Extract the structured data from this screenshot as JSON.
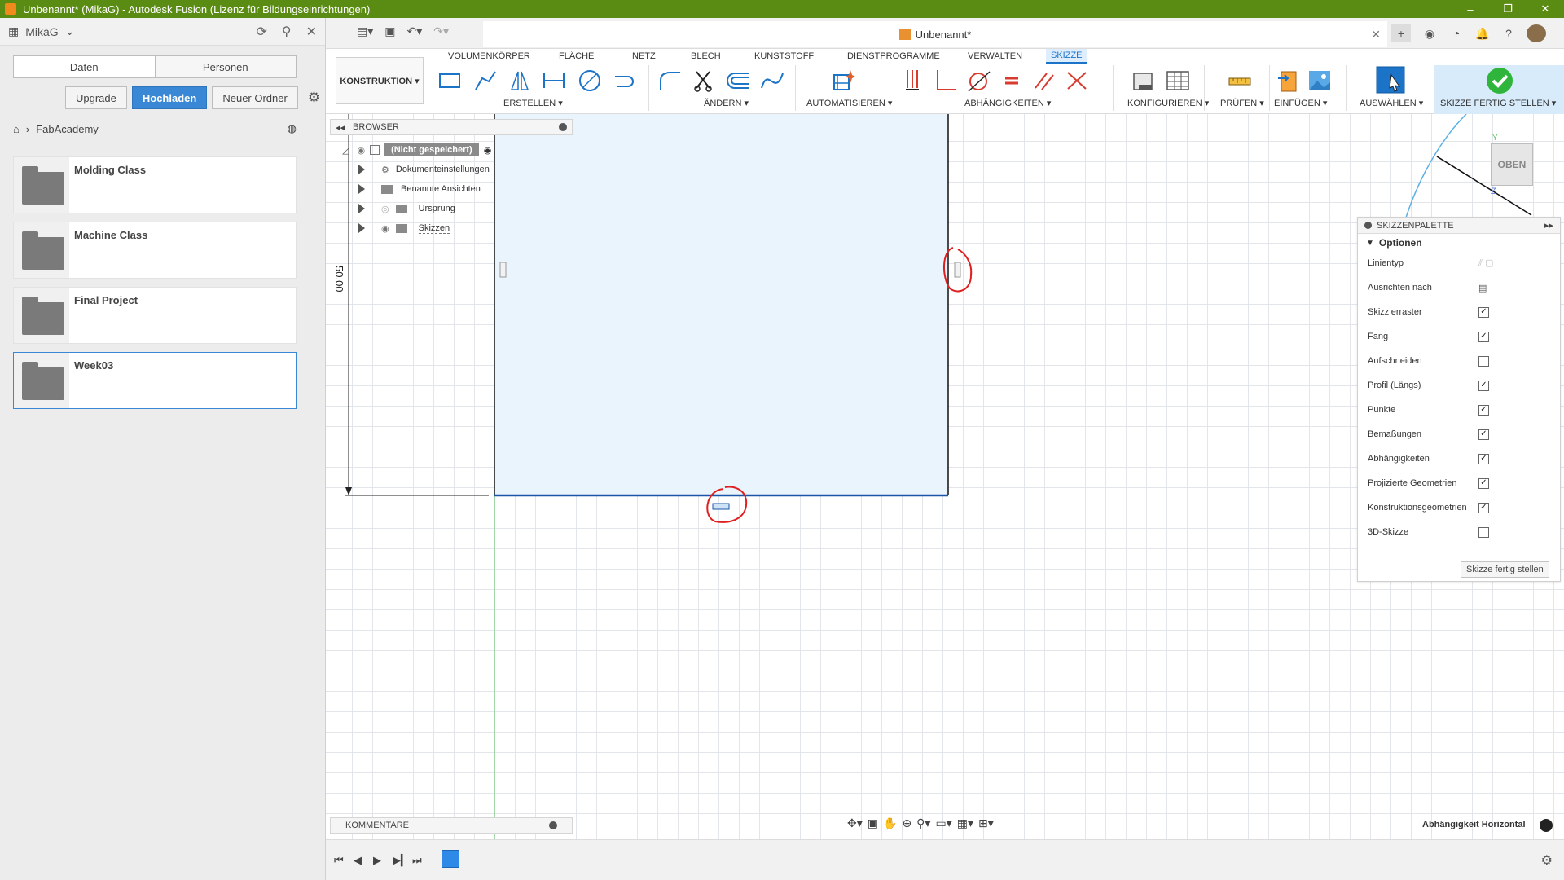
{
  "window": {
    "title": "Unbenannt* (MikaG) - Autodesk Fusion (Lizenz für Bildungseinrichtungen)",
    "controls": [
      "–",
      "❐",
      "✕"
    ]
  },
  "data_panel": {
    "user": "MikaG",
    "tabs": [
      "Daten",
      "Personen"
    ],
    "buttons": {
      "upgrade": "Upgrade",
      "upload": "Hochladen",
      "new_folder": "Neuer Ordner"
    },
    "breadcrumb": "FabAcademy",
    "folders": [
      "Molding Class",
      "Machine Class",
      "Final Project",
      "Week03"
    ]
  },
  "document": {
    "tab_title": "Unbenannt*"
  },
  "ribbon": {
    "tabs": [
      "VOLUMENKÖRPER",
      "FLÄCHE",
      "NETZ",
      "BLECH",
      "KUNSTSTOFF",
      "DIENSTPROGRAMME",
      "VERWALTEN",
      "SKIZZE"
    ],
    "active_tab": "SKIZZE",
    "workspace": "KONSTRUKTION ▾",
    "groups": [
      "ERSTELLEN ▾",
      "ÄNDERN ▾",
      "AUTOMATISIEREN ▾",
      "ABHÄNGIGKEITEN ▾",
      "KONFIGURIEREN ▾",
      "PRÜFEN ▾",
      "EINFÜGEN ▾",
      "AUSWÄHLEN ▾",
      "SKIZZE FERTIG STELLEN ▾"
    ]
  },
  "browser": {
    "title": "BROWSER",
    "root": "(Nicht gespeichert)",
    "items": [
      "Dokumenteinstellungen",
      "Benannte Ansichten",
      "Ursprung",
      "Skizzen"
    ]
  },
  "sketch": {
    "dimension": "50.00"
  },
  "viewcube": {
    "label": "OBEN"
  },
  "palette": {
    "title": "SKIZZENPALETTE",
    "section": "Optionen",
    "rows": [
      {
        "label": "Linientyp",
        "checked": null
      },
      {
        "label": "Ausrichten nach",
        "checked": null
      },
      {
        "label": "Skizzierraster",
        "checked": true
      },
      {
        "label": "Fang",
        "checked": true
      },
      {
        "label": "Aufschneiden",
        "checked": false
      },
      {
        "label": "Profil (Längs)",
        "checked": true
      },
      {
        "label": "Punkte",
        "checked": true
      },
      {
        "label": "Bemaßungen",
        "checked": true
      },
      {
        "label": "Abhängigkeiten",
        "checked": true
      },
      {
        "label": "Projizierte Geometrien",
        "checked": true
      },
      {
        "label": "Konstruktionsgeometrien",
        "checked": true
      },
      {
        "label": "3D-Skizze",
        "checked": false
      }
    ],
    "finish_button": "Skizze fertig stellen"
  },
  "comments": {
    "title": "KOMMENTARE"
  },
  "status": {
    "text": "Abhängigkeit Horizontal"
  },
  "colors": {
    "titlebar": "#5a8b12",
    "accent": "#1b74c8",
    "sketch_fill": "#eaf4fc",
    "annotation": "#e02020"
  }
}
